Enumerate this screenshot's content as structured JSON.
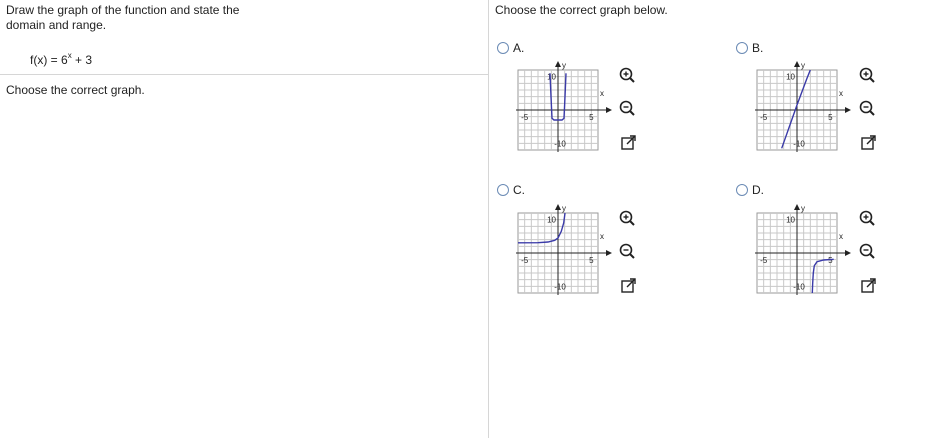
{
  "question": {
    "instruction": "Draw the graph of the function and state the domain and range.",
    "function_prefix": "f(x) = 6",
    "function_exponent": "x",
    "function_suffix": " + 3",
    "prompt_left": "Choose the correct graph."
  },
  "answer": {
    "prompt": "Choose the correct graph below.",
    "options": [
      {
        "label": "A.",
        "axis": {
          "x": "x",
          "y": "y",
          "y_top": "10",
          "y_bottom": "-10",
          "x_left": "-5",
          "x_right": "5"
        },
        "curve": "u-shape"
      },
      {
        "label": "B.",
        "axis": {
          "x": "x",
          "y": "y",
          "y_top": "10",
          "y_bottom": "-10",
          "x_left": "-5",
          "x_right": "5"
        },
        "curve": "steep-line"
      },
      {
        "label": "C.",
        "axis": {
          "x": "x",
          "y": "y",
          "y_top": "10",
          "y_bottom": "-10",
          "x_left": "-5",
          "x_right": "5"
        },
        "curve": "exponential-growth"
      },
      {
        "label": "D.",
        "axis": {
          "x": "x",
          "y": "y",
          "y_top": "10",
          "y_bottom": "-10",
          "x_left": "-5",
          "x_right": "5"
        },
        "curve": "right-branch"
      }
    ]
  },
  "icons": {
    "zoom_in": "zoom-in-icon",
    "zoom_out": "zoom-out-icon",
    "popout": "popout-icon"
  },
  "colors": {
    "curve": "#3a3aa8",
    "radio_border": "#6b8bb5",
    "grid": "#c8c8c8",
    "axis": "#222222",
    "divider": "#d6d6d6"
  }
}
